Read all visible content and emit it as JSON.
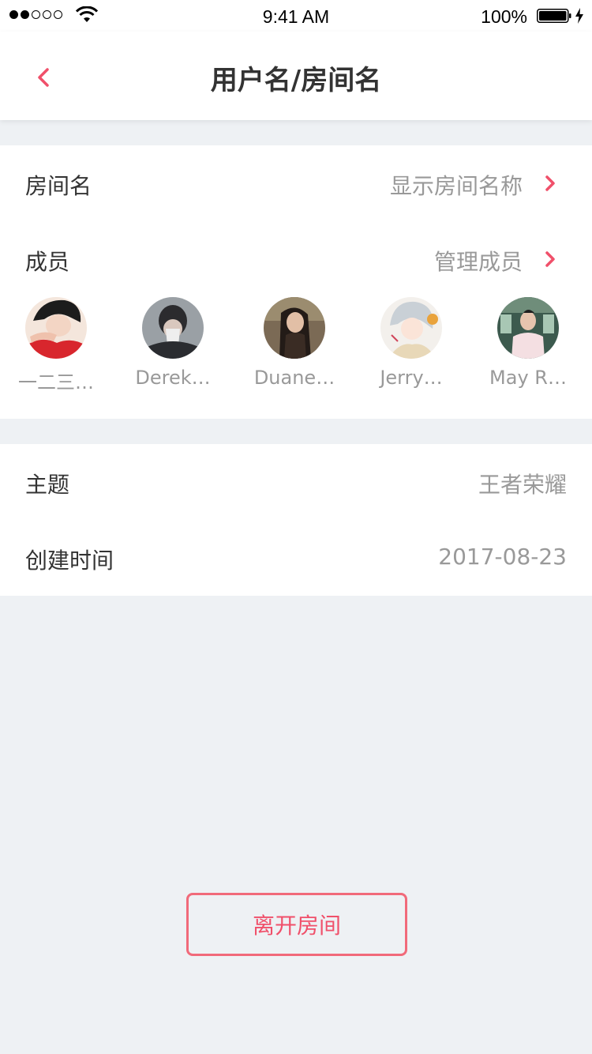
{
  "status_bar": {
    "time": "9:41 AM",
    "battery": "100%"
  },
  "nav": {
    "title": "用户名/房间名",
    "back_icon": "chevron-left-icon"
  },
  "room": {
    "name_label": "房间名",
    "name_value": "显示房间名称",
    "members_label": "成员",
    "members_action": "管理成员",
    "members": [
      {
        "name": "一二三…",
        "avatar": "avatar-anime-boy-red"
      },
      {
        "name": "Derek…",
        "avatar": "avatar-person-gray"
      },
      {
        "name": "Duane…",
        "avatar": "avatar-girl-long-hair"
      },
      {
        "name": "Jerry…",
        "avatar": "avatar-anime-girl-silver"
      },
      {
        "name": "May R…",
        "avatar": "avatar-person-pink-shirt"
      }
    ]
  },
  "details": {
    "topic_label": "主题",
    "topic_value": "王者荣耀",
    "created_label": "创建时间",
    "created_value": "2017-08-23"
  },
  "actions": {
    "leave_label": "离开房间"
  },
  "colors": {
    "accent": "#f0506a",
    "background": "#eef1f4",
    "secondary_text": "#999999",
    "primary_text": "#333333"
  }
}
